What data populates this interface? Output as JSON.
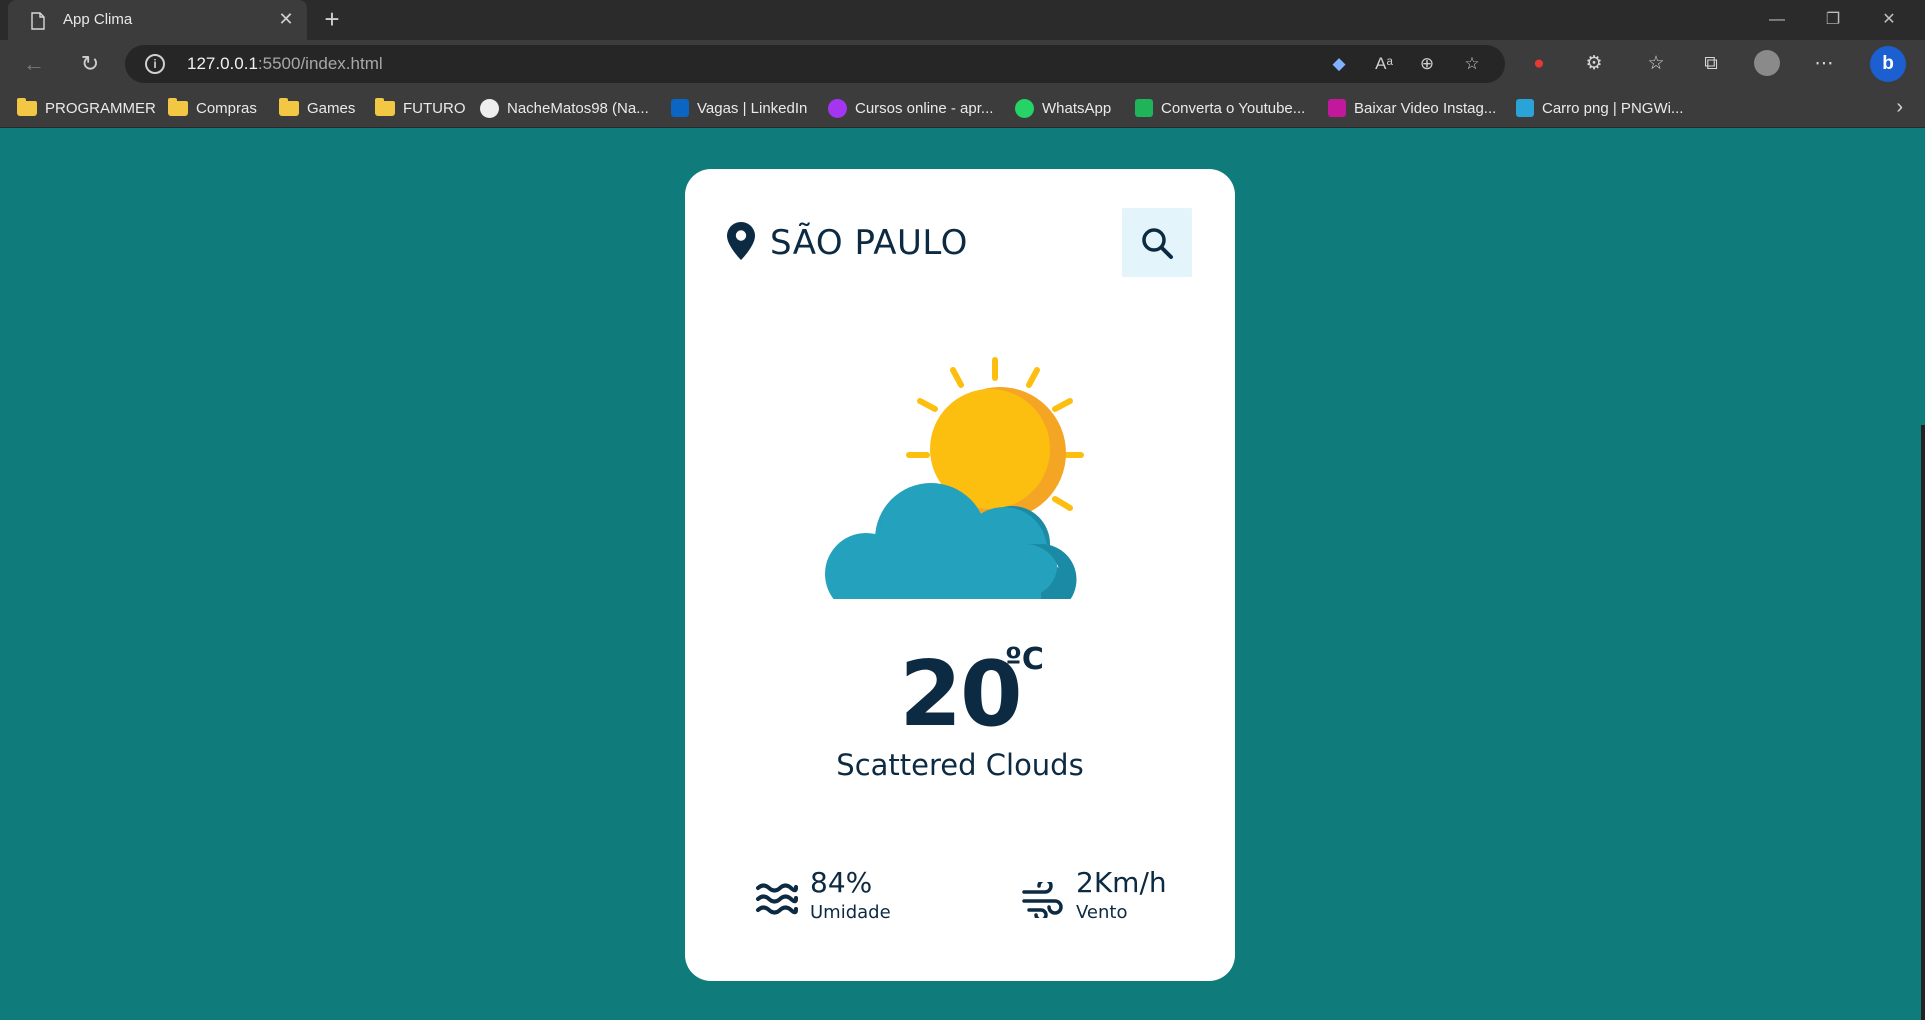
{
  "browser": {
    "tab_title": "App Clima",
    "url_host": "127.0.0.1",
    "url_rest": ":5500/index.html",
    "bookmarks": [
      {
        "label": "PROGRAMMER",
        "icon": "folder-icon"
      },
      {
        "label": "Compras",
        "icon": "folder-icon"
      },
      {
        "label": "Games",
        "icon": "folder-icon"
      },
      {
        "label": "FUTURO",
        "icon": "folder-icon"
      },
      {
        "label": "NacheMatos98 (Na...",
        "icon": "github-icon"
      },
      {
        "label": "Vagas | LinkedIn",
        "icon": "linkedin-icon"
      },
      {
        "label": "Cursos online - apr...",
        "icon": "udemy-icon"
      },
      {
        "label": "WhatsApp",
        "icon": "whatsapp-icon"
      },
      {
        "label": "Converta o Youtube...",
        "icon": "download-icon"
      },
      {
        "label": "Baixar Video Instag...",
        "icon": "instagram-icon"
      },
      {
        "label": "Carro png | PNGWi...",
        "icon": "pngwing-icon"
      }
    ]
  },
  "weather": {
    "city": "SÃO PAULO",
    "temperature": "20",
    "unit": "ºC",
    "description": "Scattered Clouds",
    "icon": "sun-behind-cloud-icon",
    "humidity": {
      "value": "84%",
      "label": "Umidade"
    },
    "wind": {
      "value": "2Km/h",
      "label": "Vento"
    }
  },
  "colors": {
    "page_background": "#0f7b7a",
    "card_background": "#ffffff",
    "text_primary": "#0c2a42",
    "search_button_bg": "#e3f4fb",
    "sun": "#fcbf0f",
    "sun_shade": "#f5a524",
    "cloud": "#24a2bd",
    "cloud_shade": "#1a8aa5"
  }
}
